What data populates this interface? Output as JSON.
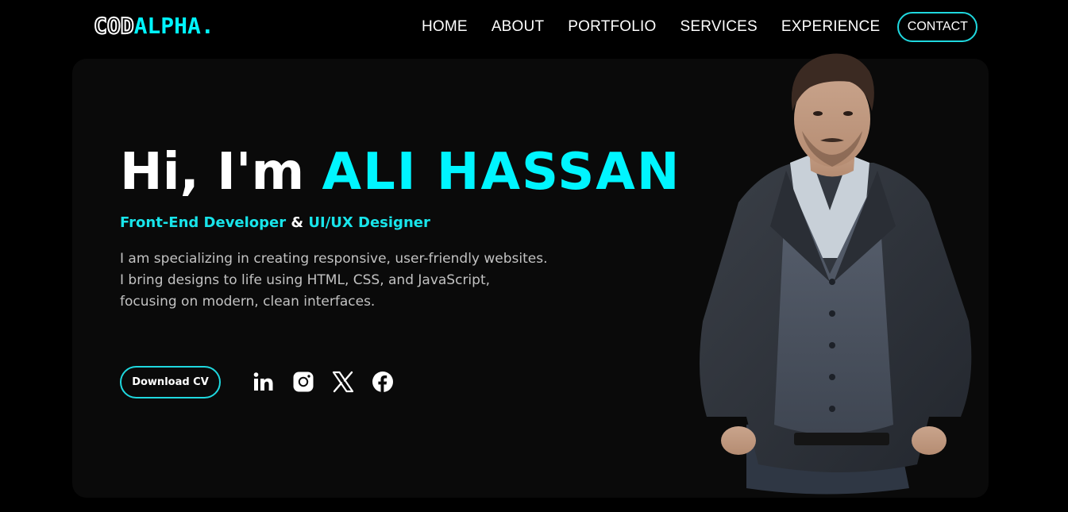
{
  "logo": {
    "part1": "COD",
    "part2": "ALPHA."
  },
  "nav": {
    "items": [
      {
        "label": "HOME"
      },
      {
        "label": "ABOUT"
      },
      {
        "label": "PORTFOLIO"
      },
      {
        "label": "SERVICES"
      },
      {
        "label": "EXPERIENCE"
      }
    ],
    "contact_label": "CONTACT"
  },
  "hero": {
    "greeting": "Hi, I'm ",
    "name": "ALI HASSAN",
    "role1": "Front-End Developer",
    "amp": " & ",
    "role2": "UI/UX Designer",
    "description": [
      "I am specializing in creating responsive, user-friendly websites.",
      "I bring designs to life using HTML, CSS, and JavaScript,",
      "focusing on modern, clean interfaces."
    ],
    "cv_button": "Download CV"
  },
  "social": [
    "linkedin-icon",
    "instagram-icon",
    "x-icon",
    "facebook-icon"
  ],
  "colors": {
    "accent": "#00f5ff",
    "background": "#000000",
    "card": "#0a0a0a",
    "border": "#1fd8df"
  }
}
